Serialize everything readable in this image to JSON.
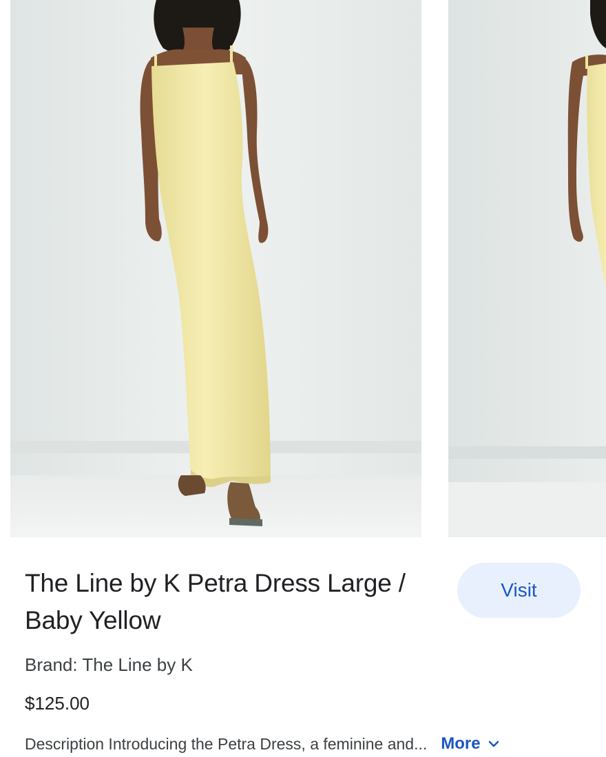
{
  "product": {
    "title": "The Line by K Petra Dress Large / Baby Yellow",
    "brand_line": "Brand: The Line by K",
    "price": "$125.00",
    "description": "Description Introducing the Petra Dress, a feminine and...",
    "more_label": "More"
  },
  "actions": {
    "visit_label": "Visit"
  },
  "images": [
    {
      "subject": "model-in-yellow-maxi-dress"
    },
    {
      "subject": "model-in-yellow-maxi-dress-partial"
    }
  ],
  "colors": {
    "accent": "#1a56c4",
    "visit_button_bg": "#e8f0fe",
    "dress": "#f2e9a6",
    "wall": "#e6ebea"
  }
}
